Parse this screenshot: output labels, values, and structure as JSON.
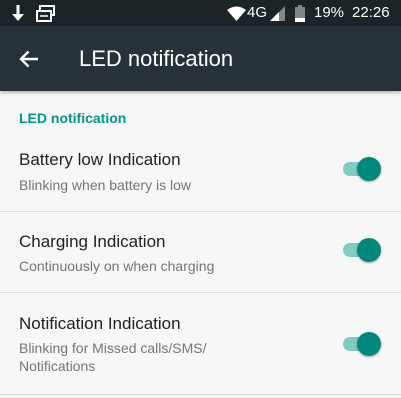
{
  "status_bar": {
    "left_icons": [
      "download-arrow-icon",
      "message-icon"
    ],
    "network": "4G",
    "battery": "19%",
    "time": "22:26",
    "right_icons": [
      "wifi-icon",
      "signal-icon",
      "battery-icon"
    ]
  },
  "app_bar": {
    "title": "LED notification",
    "back_icon": "back-arrow-icon"
  },
  "section": {
    "header": "LED notification"
  },
  "items": [
    {
      "title": "Battery low Indication",
      "summary": "Blinking when battery is low",
      "enabled": true
    },
    {
      "title": "Charging Indication",
      "summary": "Continuously on when charging",
      "enabled": true
    },
    {
      "title": "Notification Indication",
      "summary": "Blinking for Missed calls/SMS/ Notifications",
      "enabled": true
    }
  ],
  "colors": {
    "status_bar": "#1b2426",
    "app_bar": "#263238",
    "accent": "#009688",
    "switch_thumb": "#00897b",
    "switch_track": "#80cbc4",
    "background": "#f7f7f7"
  }
}
